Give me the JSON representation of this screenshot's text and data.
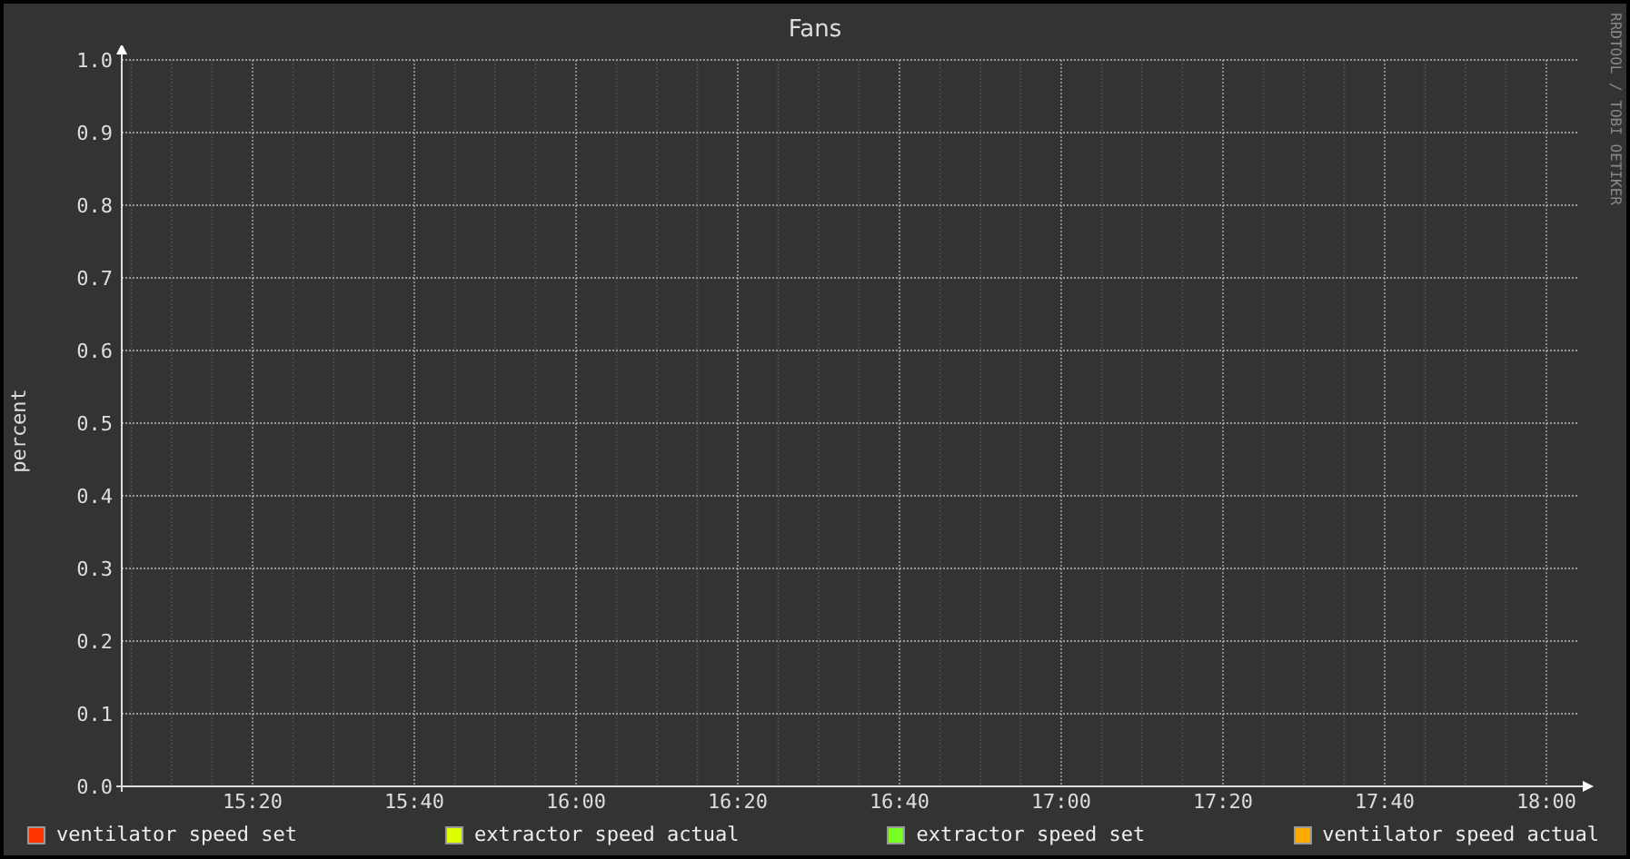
{
  "graph": {
    "side_text": "RRDTOOL / TOBI OETIKER",
    "chart_data": {
      "type": "line",
      "title": "Fans",
      "ylabel": "percent",
      "categories": [
        "15:20",
        "15:40",
        "16:00",
        "16:20",
        "16:40",
        "17:00",
        "17:20",
        "17:40",
        "18:00"
      ],
      "ylim": [
        0,
        1
      ],
      "grid": true,
      "yticks": [
        {
          "value": 0,
          "label": "0.0"
        },
        {
          "value": 0.1,
          "label": "0.1"
        },
        {
          "value": 0.2,
          "label": "0.2"
        },
        {
          "value": 0.3,
          "label": "0.3"
        },
        {
          "value": 0.4,
          "label": "0.4"
        },
        {
          "value": 0.5,
          "label": "0.5"
        },
        {
          "value": 0.6,
          "label": "0.6"
        },
        {
          "value": 0.7,
          "label": "0.7"
        },
        {
          "value": 0.8,
          "label": "0.8"
        },
        {
          "value": 0.9,
          "label": "0.9"
        },
        {
          "value": 1,
          "label": "1.0"
        }
      ],
      "series": [
        {
          "name": "ventilator speed set",
          "color": "#ff3300",
          "values": [
            null,
            null,
            null,
            null,
            null,
            null,
            null,
            null,
            null
          ]
        },
        {
          "name": "extractor speed actual",
          "color": "#ddff00",
          "values": [
            null,
            null,
            null,
            null,
            null,
            null,
            null,
            null,
            null
          ]
        },
        {
          "name": "extractor speed set",
          "color": "#77ff22",
          "values": [
            null,
            null,
            null,
            null,
            null,
            null,
            null,
            null,
            null
          ]
        },
        {
          "name": "ventilator speed actual",
          "color": "#ffaa00",
          "values": [
            null,
            null,
            null,
            null,
            null,
            null,
            null,
            null,
            null
          ]
        }
      ]
    }
  }
}
